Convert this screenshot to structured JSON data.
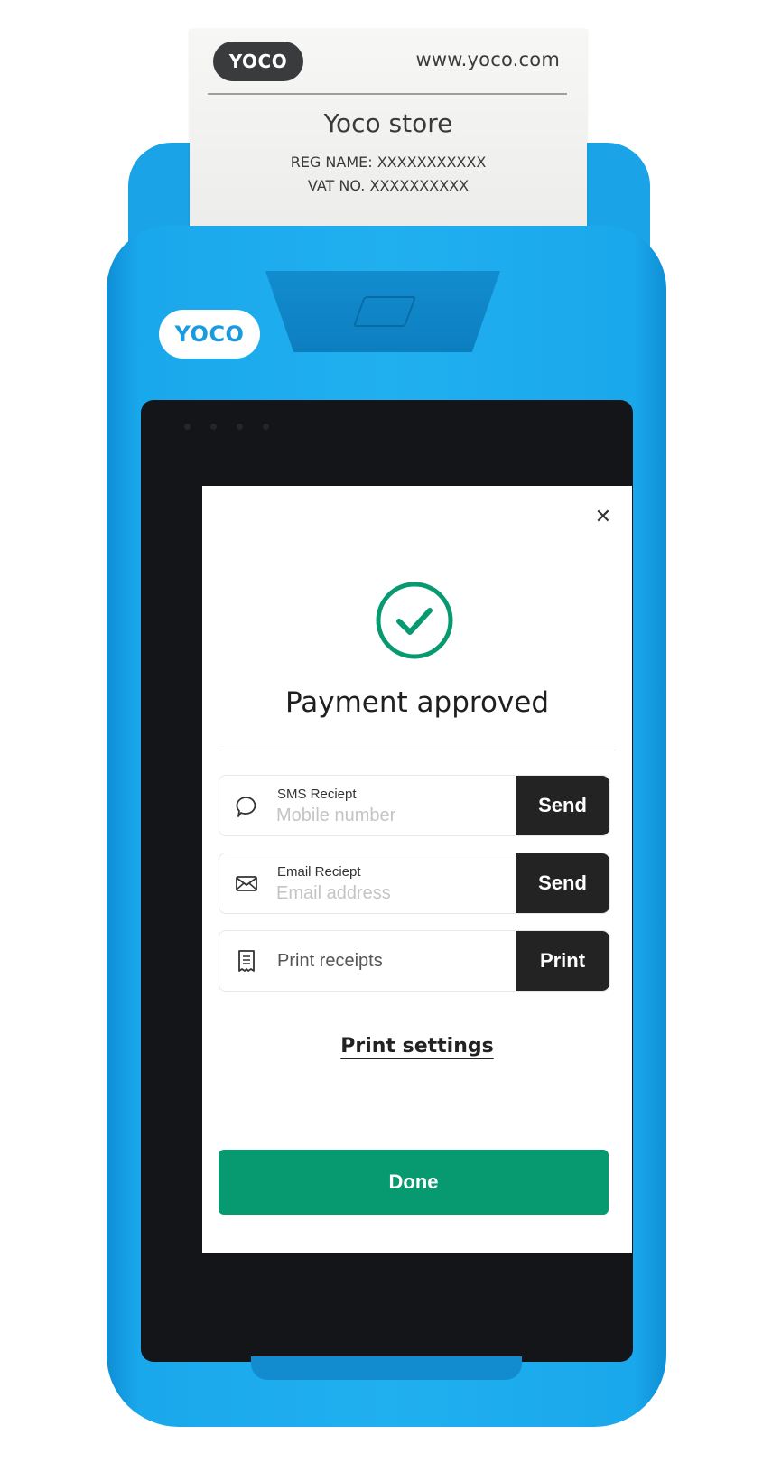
{
  "receipt": {
    "logo": "YOCO",
    "url": "www.yoco.com",
    "store_name": "Yoco store",
    "reg_name": "REG NAME: XXXXXXXXXXX",
    "vat_no": "VAT NO. XXXXXXXXXX"
  },
  "device": {
    "logo": "YOCO"
  },
  "screen": {
    "close_glyph": "✕",
    "title": "Payment approved",
    "sms": {
      "label": "SMS Reciept",
      "placeholder": "Mobile number",
      "button": "Send",
      "icon": "chat-bubble-icon"
    },
    "email": {
      "label": "Email Reciept",
      "placeholder": "Email address",
      "button": "Send",
      "icon": "envelope-icon"
    },
    "print": {
      "label": "Print receipts",
      "button": "Print",
      "icon": "receipt-icon"
    },
    "print_settings": "Print settings",
    "done": "Done"
  },
  "colors": {
    "device_blue": "#20afef",
    "success_green": "#079a70",
    "button_dark": "#232323"
  }
}
